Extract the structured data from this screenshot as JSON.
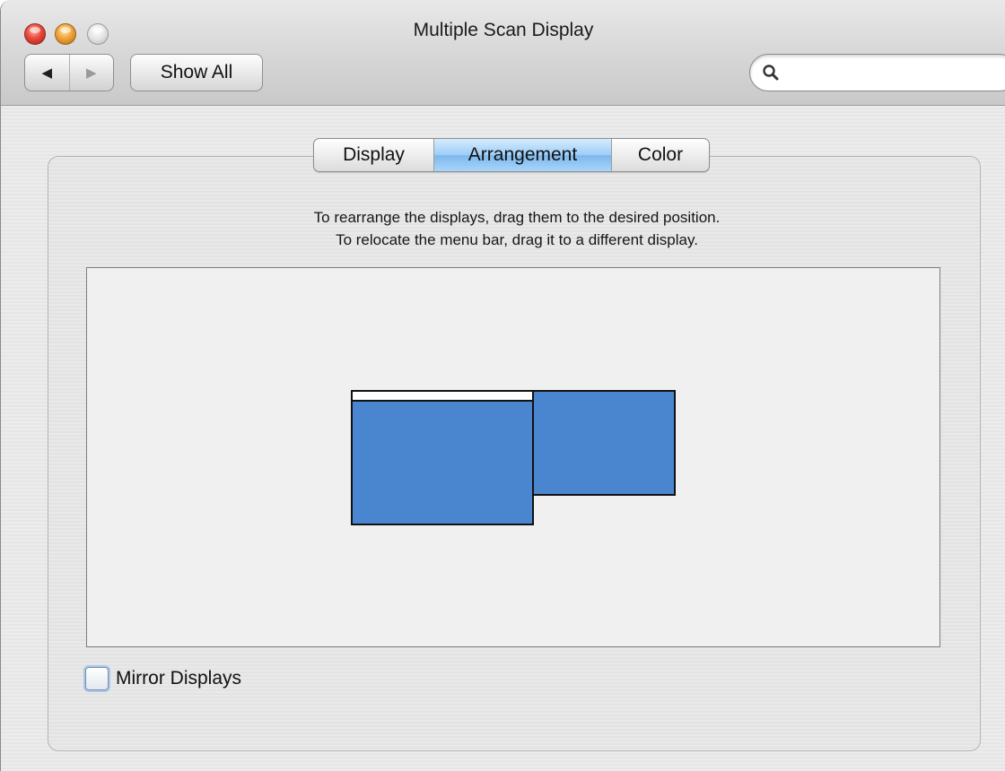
{
  "window": {
    "title": "Multiple Scan Display"
  },
  "toolbar": {
    "back_icon": "back-arrow-icon",
    "forward_icon": "forward-arrow-icon",
    "show_all_label": "Show All",
    "search": {
      "value": "",
      "placeholder": ""
    }
  },
  "tabs": [
    {
      "label": "Display",
      "selected": false
    },
    {
      "label": "Arrangement",
      "selected": true
    },
    {
      "label": "Color",
      "selected": false
    }
  ],
  "arrangement": {
    "instructions": [
      "To rearrange the displays, drag them to the desired position.",
      "To relocate the menu bar, drag it to a different display."
    ],
    "display_color": "#4a86d0"
  },
  "mirror_displays": {
    "label": "Mirror Displays",
    "checked": false
  }
}
